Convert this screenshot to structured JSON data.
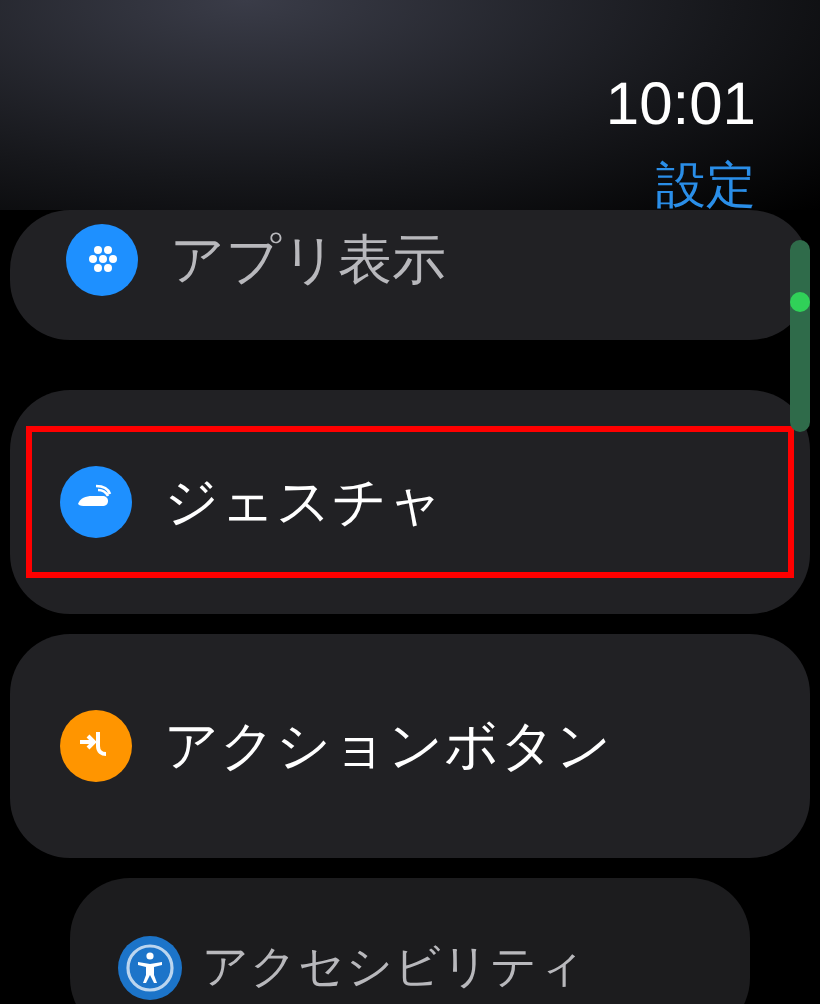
{
  "status_bar": {
    "time": "10:01"
  },
  "title": "設定",
  "items": [
    {
      "label": "アプリ表示",
      "color": "#1e90ff",
      "dimmed": true,
      "highlighted": false
    },
    {
      "label": "ジェスチャ",
      "color": "#1e90ff",
      "dimmed": false,
      "highlighted": true
    },
    {
      "label": "アクションボタン",
      "color": "#ff9500",
      "dimmed": false,
      "highlighted": false
    },
    {
      "label": "アクセシビリティ",
      "color": "#1c74c9",
      "dimmed": true,
      "highlighted": false
    }
  ]
}
